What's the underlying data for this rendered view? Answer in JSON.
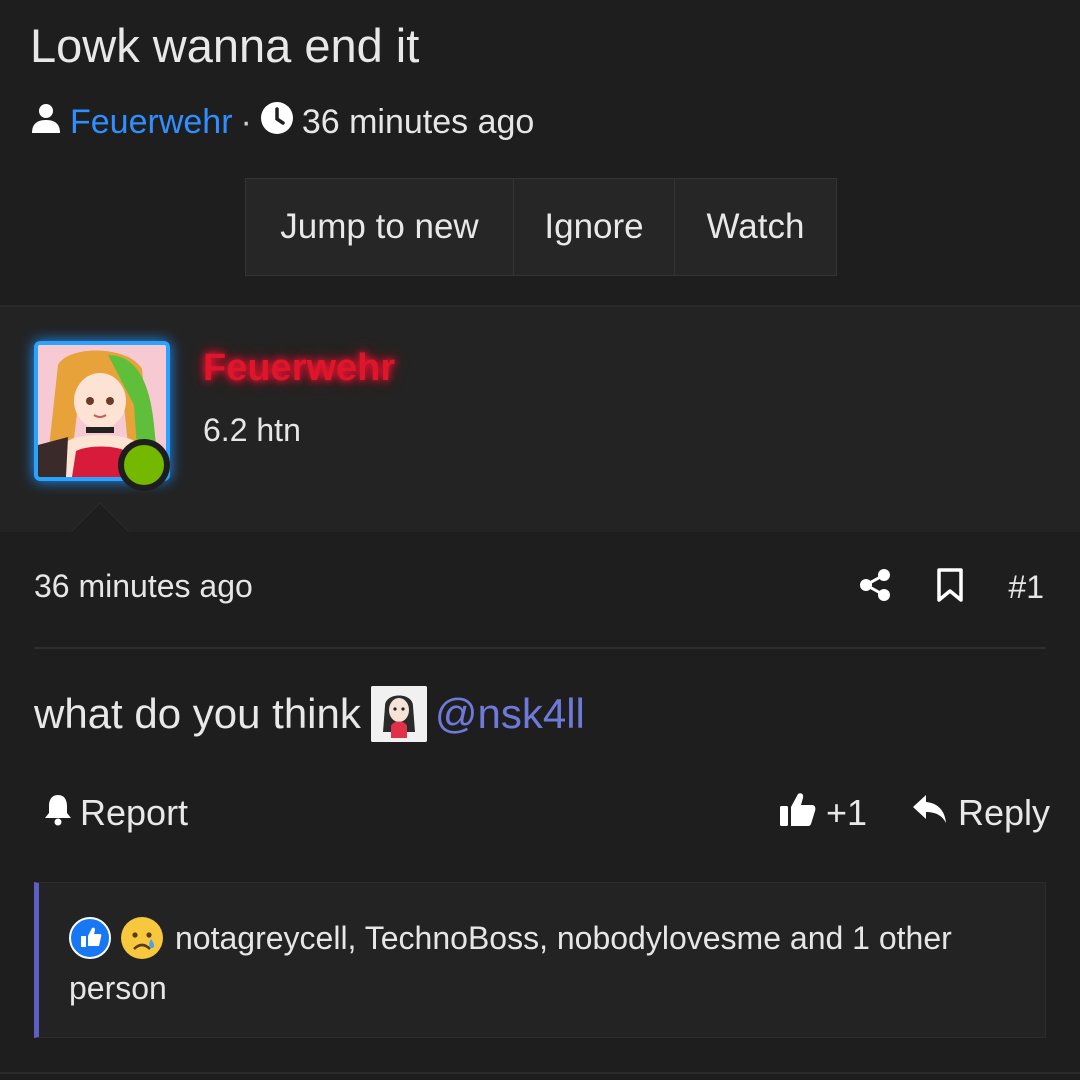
{
  "thread": {
    "title": "Lowk wanna end it",
    "author": "Feuerwehr",
    "separator": "·",
    "time": "36 minutes ago"
  },
  "buttons": {
    "jump": "Jump to new",
    "ignore": "Ignore",
    "watch": "Watch"
  },
  "user": {
    "name": "Feuerwehr",
    "title": "6.2 htn",
    "status": "online"
  },
  "post": {
    "time": "36 minutes ago",
    "number": "#1",
    "body_text": "what do you think",
    "mention": "@nsk4ll",
    "report": "Report",
    "like_count": "+1",
    "reply": "Reply"
  },
  "reactions": {
    "text": "notagreycell, TechnoBoss, nobodylovesme and 1 other person",
    "icons": [
      "like-icon",
      "sad-face-icon"
    ]
  },
  "colors": {
    "background": "#1e1e1e",
    "author_link": "#2f8fff",
    "username_red": "#e0142a",
    "mention": "#6f79d8",
    "online": "#74b800",
    "reaction_bar": "#5c5fc4"
  }
}
